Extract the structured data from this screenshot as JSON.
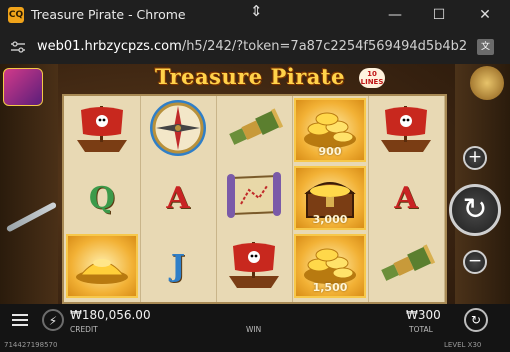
{
  "window": {
    "title": "Treasure Pirate - Chrome",
    "app_icon_text": "CQ",
    "minimize_glyph": "—",
    "maximize_glyph": "☐",
    "close_glyph": "✕"
  },
  "address_bar": {
    "url_host": "web01.hrbzycpzs.com",
    "url_rest": "/h5/242/?token=7a87c2254f569494d5b4b2..."
  },
  "game": {
    "logo": "Treasure Pirate",
    "lines_badge": "10 LINES",
    "reels": [
      [
        {
          "symbol": "pirate-ship"
        },
        {
          "symbol": "Q",
          "color": "#3c9a4a"
        },
        {
          "symbol": "gold-coins-pile",
          "highlight": true
        }
      ],
      [
        {
          "symbol": "compass"
        },
        {
          "symbol": "A",
          "color": "#c82323"
        },
        {
          "symbol": "J",
          "color": "#2f7fc8"
        }
      ],
      [
        {
          "symbol": "spyglass"
        },
        {
          "symbol": "treasure-map"
        },
        {
          "symbol": "pirate-ship"
        }
      ],
      [
        {
          "symbol": "gold-coins",
          "highlight": true,
          "value": "900"
        },
        {
          "symbol": "treasure-chest",
          "highlight": true,
          "value": "3,000"
        },
        {
          "symbol": "gold-coins",
          "highlight": true,
          "value": "1,500"
        }
      ],
      [
        {
          "symbol": "pirate-ship"
        },
        {
          "symbol": "A",
          "color": "#c82323"
        },
        {
          "symbol": "spyglass"
        }
      ]
    ],
    "buttons": {
      "plus_glyph": "+",
      "minus_glyph": "−",
      "spin_glyph": "↻"
    }
  },
  "footer": {
    "credit_value": "₩180,056.00",
    "credit_label": "CREDIT",
    "win_label": "WIN",
    "total_value": "₩300",
    "total_label": "TOTAL",
    "round_id": "714427198570",
    "level_text": "LEVEL  X30",
    "bolt_glyph": "⚡",
    "autospin_glyph": "↻"
  },
  "colors": {
    "highlight_gold": "#f2b135",
    "parchment": "#e8d9b4",
    "logo_gold": "#ffd24a"
  }
}
